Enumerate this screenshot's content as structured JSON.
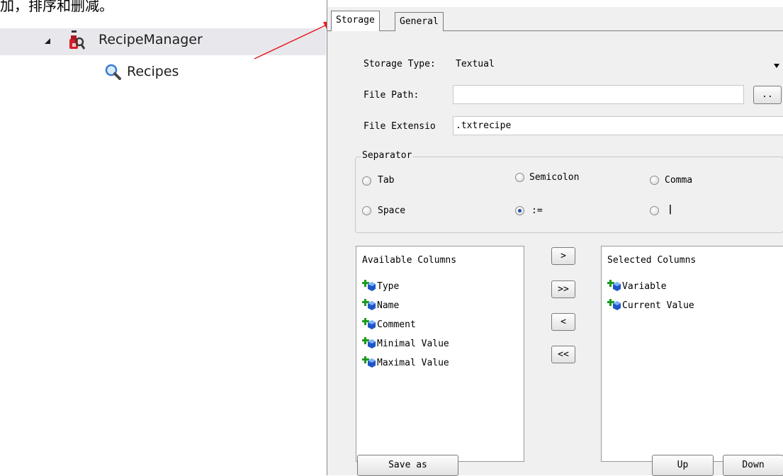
{
  "doc": {
    "intro_text": "加，排序和删减。"
  },
  "tree": {
    "items": [
      {
        "label": "RecipeManager"
      },
      {
        "label": "Recipes"
      }
    ]
  },
  "dialog": {
    "tabs": [
      {
        "label": "Storage"
      },
      {
        "label": "General"
      }
    ],
    "storage_type": {
      "label": "Storage Type:",
      "value": "Textual"
    },
    "file_path": {
      "label": "File Path:",
      "value": "",
      "browse_label": ".."
    },
    "file_extension": {
      "label": "File Extensio",
      "value": ".txtrecipe"
    },
    "separator": {
      "title": "Separator",
      "options": [
        {
          "label": "Tab",
          "checked": false
        },
        {
          "label": "Semicolon",
          "checked": false
        },
        {
          "label": "Comma",
          "checked": false
        },
        {
          "label": "Space",
          "checked": false
        },
        {
          "label": ":=",
          "checked": true
        },
        {
          "label": "|",
          "checked": false
        }
      ]
    },
    "available_columns": {
      "header": "Available Columns",
      "items": [
        "Type",
        "Name",
        "Comment",
        "Minimal Value",
        "Maximal Value"
      ]
    },
    "selected_columns": {
      "header": "Selected Columns",
      "items": [
        "Variable",
        "Current Value"
      ]
    },
    "move_buttons": {
      "add": ">",
      "add_all": ">>",
      "remove": "<",
      "remove_all": "<<"
    },
    "bottom_buttons": {
      "save_as": "Save as",
      "up": "Up",
      "down": "Down"
    }
  },
  "colors": {
    "arrow": "#e8161f",
    "selection_bg": "#e8e8ec",
    "dialog_bg": "#f0f0f0"
  }
}
